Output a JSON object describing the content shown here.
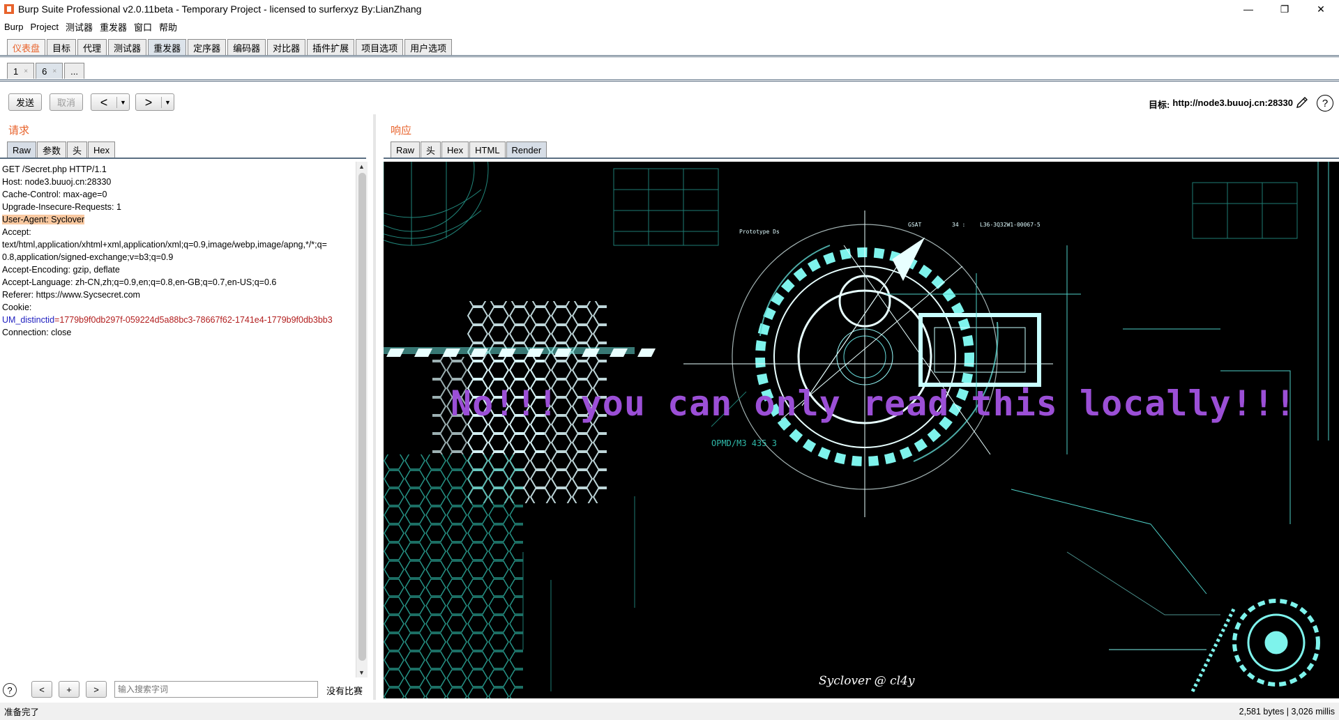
{
  "window": {
    "title": "Burp Suite Professional v2.0.11beta - Temporary Project - licensed to surferxyz By:LianZhang",
    "minimize": "—",
    "maximize": "❐",
    "close": "✕"
  },
  "menubar": [
    "Burp",
    "Project",
    "测试器",
    "重发器",
    "窗口",
    "帮助"
  ],
  "main_tabs": [
    "仪表盘",
    "目标",
    "代理",
    "测试器",
    "重发器",
    "定序器",
    "编码器",
    "对比器",
    "插件扩展",
    "项目选项",
    "用户选项"
  ],
  "sub_tabs": [
    {
      "label": "1",
      "close": "×"
    },
    {
      "label": "6",
      "close": "×"
    },
    {
      "label": "..."
    }
  ],
  "toolbar": {
    "send": "发送",
    "cancel": "取消",
    "back_glyph": "<",
    "forward_glyph": ">",
    "dropdown": "▼",
    "target_label": "目标:",
    "target_url": "http://node3.buuoj.cn:28330",
    "help": "?"
  },
  "request": {
    "label": "请求",
    "tabs": [
      "Raw",
      "参数",
      "头",
      "Hex"
    ],
    "lines": [
      "GET /Secret.php HTTP/1.1",
      "Host: node3.buuoj.cn:28330",
      "Cache-Control: max-age=0",
      "Upgrade-Insecure-Requests: 1",
      "User-Agent: Syclover",
      "Accept:",
      "text/html,application/xhtml+xml,application/xml;q=0.9,image/webp,image/apng,*/*;q=",
      "0.8,application/signed-exchange;v=b3;q=0.9",
      "Accept-Encoding: gzip, deflate",
      "Accept-Language: zh-CN,zh;q=0.9,en;q=0.8,en-GB;q=0.7,en-US;q=0.6",
      "Referer: https://www.Sycsecret.com",
      "Cookie:"
    ],
    "cookie_name": "UM_distinctid",
    "cookie_eq": "=",
    "cookie_value": "1779b9f0db297f-059224d5a88bc3-78667f62-1741e4-1779b9f0db3bb3",
    "last_line": "Connection: close"
  },
  "search": {
    "help": "?",
    "prev": "<",
    "add": "+",
    "next": ">",
    "placeholder": "输入搜索字词",
    "matches": "没有比赛"
  },
  "response": {
    "label": "响应",
    "tabs": [
      "Raw",
      "头",
      "Hex",
      "HTML",
      "Render"
    ],
    "headline": "No!!! you can only read this locally!!!",
    "signature": "Syclover @ cl4y"
  },
  "status": {
    "left": "准备完了",
    "right": "2,581 bytes | 3,026 millis"
  }
}
